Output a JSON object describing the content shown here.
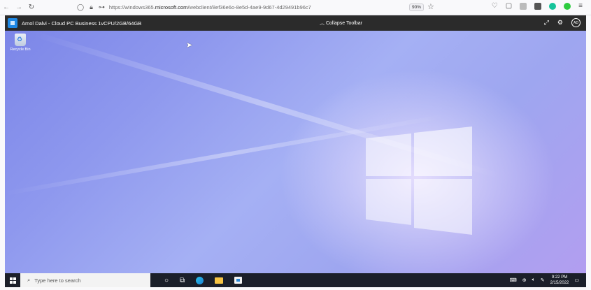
{
  "browser": {
    "back_icon": "arrow-left-icon",
    "forward_icon": "arrow-right-icon",
    "reload_icon": "reload-icon",
    "url_prefix": "https://windows365.",
    "url_domain": "microsoft.com",
    "url_path": "/webclient/8ef36e6o-8e5d-4ae9-9d67-4d29491b96c7",
    "zoom": "90%"
  },
  "session": {
    "title": "Amol Dalvi - Cloud PC Business 1vCPU/2GB/64GB",
    "collapse_label": "Collapse Toolbar",
    "avatar_initials": "AD"
  },
  "desktop": {
    "recycle_bin_label": "Recycle Bin"
  },
  "taskbar": {
    "search_placeholder": "Type here to search",
    "time": "9:22 PM",
    "date": "2/15/2022"
  },
  "colors": {
    "toolbar_bg": "#2b2b2b",
    "taskbar_bg": "#1b1f2a",
    "accent": "#1e88e5"
  }
}
